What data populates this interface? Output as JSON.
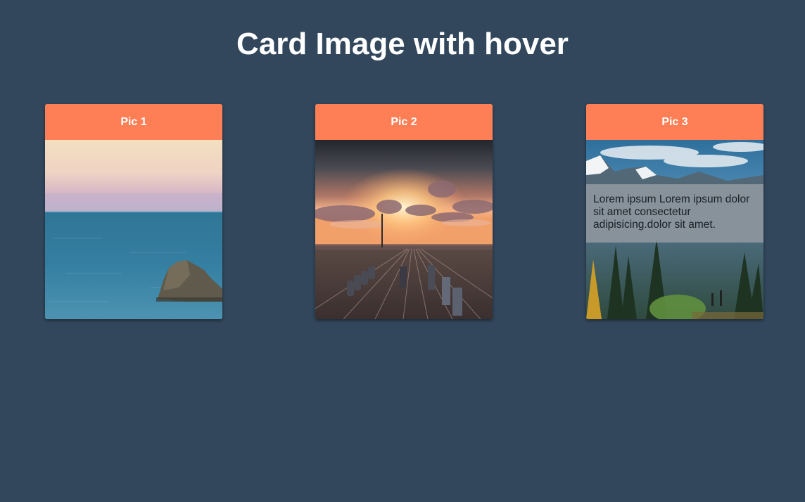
{
  "page": {
    "title": "Card Image with hover"
  },
  "colors": {
    "background": "#32475c",
    "card_header": "#fe7f55",
    "header_text": "#ffffff"
  },
  "cards": [
    {
      "label": "Pic 1",
      "image": "ocean-rock-photo",
      "hovered": false
    },
    {
      "label": "Pic 2",
      "image": "railyard-sunset-photo",
      "hovered": false
    },
    {
      "label": "Pic 3",
      "image": "mountain-forest-photo",
      "hovered": true,
      "overlay_text": "Lorem ipsum Lorem ipsum dolor sit amet consectetur adipisicing.dolor sit amet."
    }
  ]
}
